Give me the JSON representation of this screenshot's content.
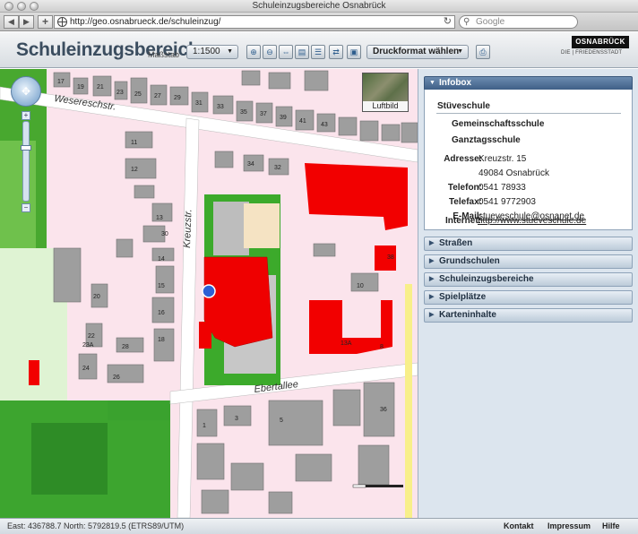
{
  "browser": {
    "window_title": "Schuleinzugsbereiche Osnabrück",
    "url": "http://geo.osnabrueck.de/schuleinzug/",
    "search_placeholder": "Google",
    "back_icon": "back-arrow-icon",
    "forward_icon": "forward-arrow-icon"
  },
  "header": {
    "title": "Schuleinzugsbereiche",
    "scale_label": "Maßstab",
    "scale_value": "1:1500",
    "print_format_label": "Druckformat wählen",
    "logo_text": "OSNABRÜCK",
    "logo_tagline": "DIE | FRIEDENSSTADT"
  },
  "map": {
    "aerial_label": "Luftbild",
    "streets": {
      "wesereschstr": "Wesereschstr.",
      "kreuzstr": "Kreuzstr.",
      "ebertallee": "Ebertallee"
    },
    "house_numbers": [
      "17",
      "19",
      "21",
      "23",
      "25",
      "27",
      "29",
      "31",
      "33",
      "35",
      "37",
      "39",
      "41",
      "43",
      "11",
      "12",
      "13",
      "14",
      "15",
      "16",
      "18",
      "20",
      "22",
      "23A",
      "24",
      "26",
      "28",
      "30",
      "32",
      "34",
      "38",
      "13A",
      "10",
      "8",
      "1",
      "3",
      "5",
      "36"
    ]
  },
  "sidebar": {
    "infobox_title": "Infobox",
    "school": {
      "name": "Stüveschule",
      "type1": "Gemeinschaftsschule",
      "type2": "Ganztagsschule",
      "address_label": "Adresse:",
      "address_line1": "Kreuzstr. 15",
      "address_line2": "49084 Osnabrück",
      "phone_label": "Telefon:",
      "phone": "0541 78933",
      "fax_label": "Telefax:",
      "fax": "0541 9772903",
      "email_label": "E-Mail:",
      "email": "stueveschule@osnanet.de",
      "internet_label": "Internet:",
      "internet": "http://www.stueveschule.de"
    },
    "sections": [
      "Straßen",
      "Grundschulen",
      "Schuleinzugsbereiche",
      "Spielplätze",
      "Karteninhalte"
    ]
  },
  "status": {
    "coordinates": "East: 436788.7 North: 5792819.5 (ETRS89/UTM)",
    "links": [
      "Kontakt",
      "Impressum",
      "Hilfe"
    ]
  }
}
